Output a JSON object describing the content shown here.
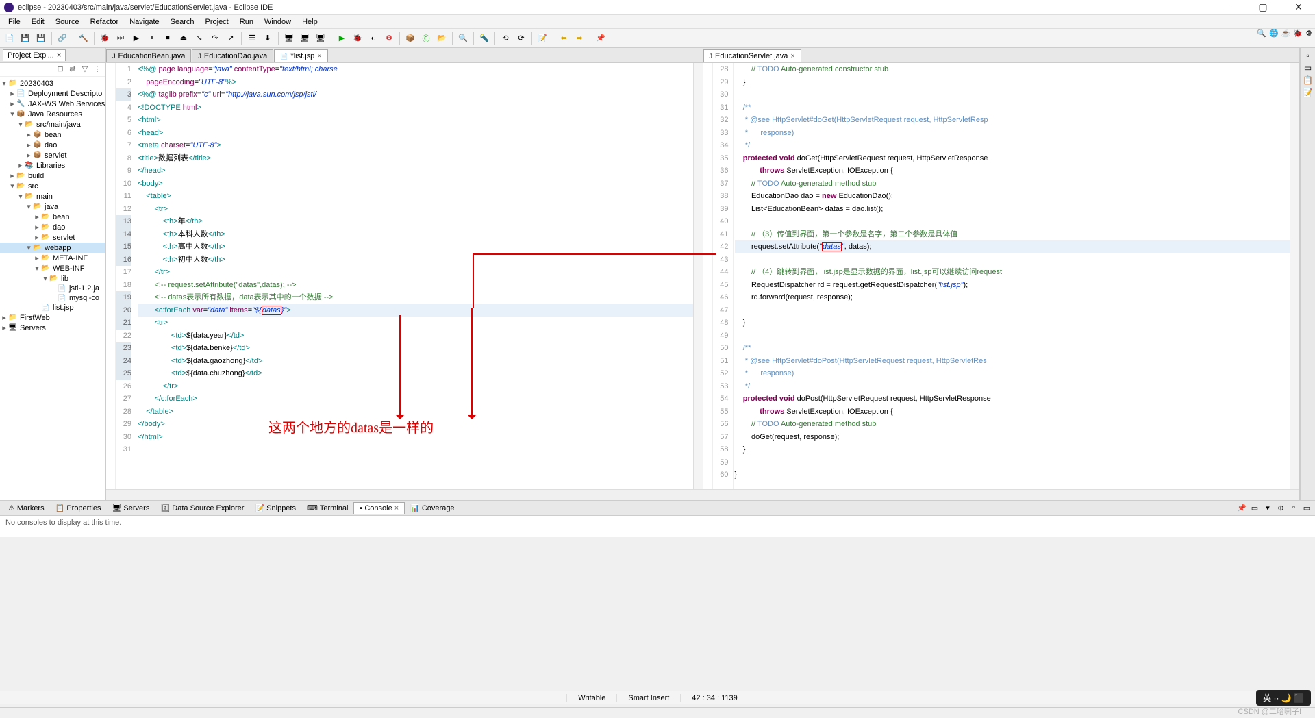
{
  "titlebar": {
    "title": "eclipse - 20230403/src/main/java/servlet/EducationServlet.java - Eclipse IDE"
  },
  "menu": [
    "File",
    "Edit",
    "Source",
    "Refactor",
    "Navigate",
    "Search",
    "Project",
    "Run",
    "Window",
    "Help"
  ],
  "explorer": {
    "title": "Project Expl...",
    "items": [
      {
        "ind": 0,
        "arrow": "▾",
        "icon": "📁",
        "label": "20230403"
      },
      {
        "ind": 1,
        "arrow": "▸",
        "icon": "📄",
        "label": "Deployment Descripto"
      },
      {
        "ind": 1,
        "arrow": "▸",
        "icon": "🔧",
        "label": "JAX-WS Web Services"
      },
      {
        "ind": 1,
        "arrow": "▾",
        "icon": "📦",
        "label": "Java Resources"
      },
      {
        "ind": 2,
        "arrow": "▾",
        "icon": "📂",
        "label": "src/main/java"
      },
      {
        "ind": 3,
        "arrow": "▸",
        "icon": "📦",
        "label": "bean"
      },
      {
        "ind": 3,
        "arrow": "▸",
        "icon": "📦",
        "label": "dao"
      },
      {
        "ind": 3,
        "arrow": "▸",
        "icon": "📦",
        "label": "servlet"
      },
      {
        "ind": 2,
        "arrow": "▸",
        "icon": "📚",
        "label": "Libraries"
      },
      {
        "ind": 1,
        "arrow": "▸",
        "icon": "📂",
        "label": "build"
      },
      {
        "ind": 1,
        "arrow": "▾",
        "icon": "📂",
        "label": "src"
      },
      {
        "ind": 2,
        "arrow": "▾",
        "icon": "📂",
        "label": "main"
      },
      {
        "ind": 3,
        "arrow": "▾",
        "icon": "📂",
        "label": "java"
      },
      {
        "ind": 4,
        "arrow": "▸",
        "icon": "📂",
        "label": "bean"
      },
      {
        "ind": 4,
        "arrow": "▸",
        "icon": "📂",
        "label": "dao"
      },
      {
        "ind": 4,
        "arrow": "▸",
        "icon": "📂",
        "label": "servlet"
      },
      {
        "ind": 3,
        "arrow": "▾",
        "icon": "📂",
        "label": "webapp",
        "sel": true
      },
      {
        "ind": 4,
        "arrow": "▸",
        "icon": "📂",
        "label": "META-INF"
      },
      {
        "ind": 4,
        "arrow": "▾",
        "icon": "📂",
        "label": "WEB-INF"
      },
      {
        "ind": 5,
        "arrow": "▾",
        "icon": "📂",
        "label": "lib"
      },
      {
        "ind": 6,
        "arrow": "",
        "icon": "📄",
        "label": "jstl-1.2.ja"
      },
      {
        "ind": 6,
        "arrow": "",
        "icon": "📄",
        "label": "mysql-co"
      },
      {
        "ind": 4,
        "arrow": "",
        "icon": "📄",
        "label": "list.jsp"
      },
      {
        "ind": 0,
        "arrow": "▸",
        "icon": "📁",
        "label": "FirstWeb"
      },
      {
        "ind": 0,
        "arrow": "▸",
        "icon": "🖥",
        "label": "Servers"
      }
    ]
  },
  "leftEditor": {
    "tabs": [
      {
        "label": "EducationBean.java",
        "icon": "J"
      },
      {
        "label": "EducationDao.java",
        "icon": "J"
      },
      {
        "label": "*list.jsp",
        "icon": "📄",
        "active": true,
        "close": true
      }
    ]
  },
  "rightEditor": {
    "tabs": [
      {
        "label": "EducationServlet.java",
        "icon": "J",
        "active": true,
        "close": true
      }
    ]
  },
  "bottomTabs": [
    {
      "icon": "⚠",
      "label": "Markers"
    },
    {
      "icon": "📋",
      "label": "Properties"
    },
    {
      "icon": "🖥",
      "label": "Servers"
    },
    {
      "icon": "🗄",
      "label": "Data Source Explorer"
    },
    {
      "icon": "📝",
      "label": "Snippets"
    },
    {
      "icon": "⌨",
      "label": "Terminal"
    },
    {
      "icon": "▪",
      "label": "Console",
      "active": true,
      "close": true
    },
    {
      "icon": "📊",
      "label": "Coverage"
    }
  ],
  "consoleMsg": "No consoles to display at this time.",
  "status": {
    "writable": "Writable",
    "insert": "Smart Insert",
    "pos": "42 : 34 : 1139"
  },
  "annotation": "这两个地方的datas是一样的",
  "watermark": "CSDN @二哈喇子!",
  "ime": "英 ·· 🌙 ⬛"
}
